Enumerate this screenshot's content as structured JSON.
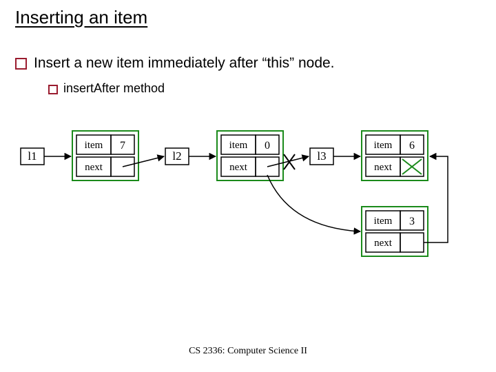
{
  "title": "Inserting an item",
  "bullet_main": "Insert a new item immediately after “this” node.",
  "bullet_sub": "insertAfter method",
  "labels": {
    "l1": "l1",
    "l2": "l2",
    "l3": "l3"
  },
  "node_labels": {
    "item": "item",
    "next": "next"
  },
  "values": {
    "n1": "7",
    "n2": "0",
    "n3": "6",
    "n4": "3"
  },
  "footer": "CS 2336: Computer Science II",
  "chart_data": {
    "type": "diagram",
    "title": "Inserting an item",
    "description": "Singly linked list with nodes l1(7)->l2(0)->l3(6), and a new node (3) being inserted immediately after l2. l2.next is shown redirected (crossed-out old pointer) to new node, new node.next points to l3, l3.next is null.",
    "nodes": [
      {
        "id": "l1",
        "value": 7,
        "next": "l2"
      },
      {
        "id": "l2",
        "value": 0,
        "next": "new",
        "old_next": "l3"
      },
      {
        "id": "new",
        "value": 3,
        "next": "l3"
      },
      {
        "id": "l3",
        "value": 6,
        "next": null
      }
    ]
  }
}
